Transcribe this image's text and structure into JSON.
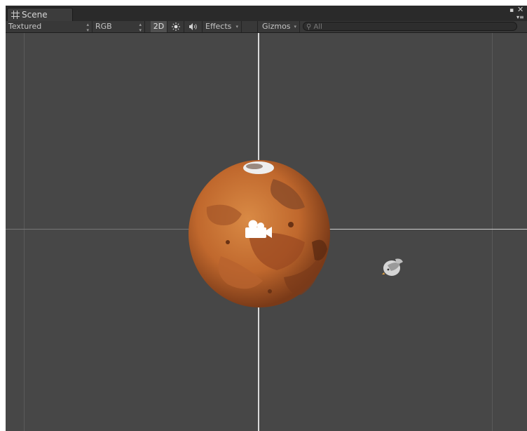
{
  "window": {
    "tab_label": "Scene",
    "tab_icon": "grid-icon"
  },
  "toolbar": {
    "draw_mode": "Textured",
    "render_mode": "RGB",
    "mode_2d": "2D",
    "lighting_icon": "sun-icon",
    "audio_icon": "speaker-icon",
    "effects_label": "Effects",
    "gizmos_label": "Gizmos",
    "search_placeholder": "All"
  },
  "scene": {
    "objects": [
      "planet-mars",
      "camera-gizmo",
      "bird-sprite"
    ],
    "colors": {
      "background": "#474747",
      "axis": "#d9d9d9",
      "planet": "#c06a2e"
    }
  }
}
